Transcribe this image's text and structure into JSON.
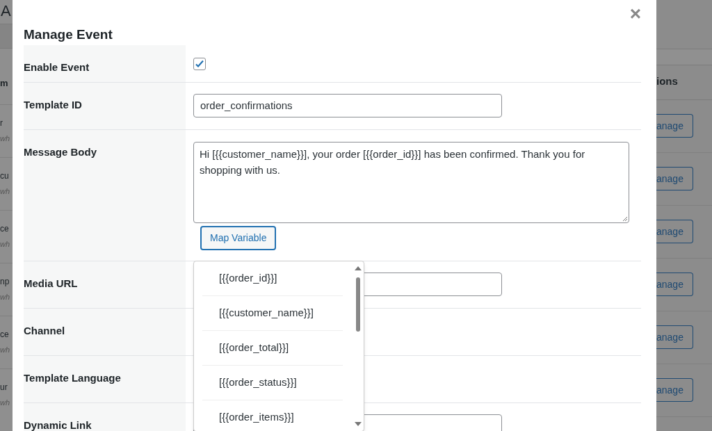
{
  "background": {
    "left_fragments": {
      "title": "A",
      "header": "m",
      "rows": [
        {
          "name": "r",
          "note": "wh"
        },
        {
          "name": "cu",
          "note": "wh"
        },
        {
          "name": "ce",
          "note": "wh"
        },
        {
          "name": "np",
          "note": "wh"
        },
        {
          "name": "ce",
          "note": "wh"
        },
        {
          "name": "ur",
          "note": "wh"
        }
      ]
    },
    "right_fragments": {
      "header": "ions",
      "buttons": [
        "anage",
        "anage",
        "anage",
        "anage",
        "anage",
        "anage"
      ]
    }
  },
  "modal": {
    "title": "Manage Event",
    "close": "×",
    "fields": [
      {
        "kind": "checkbox",
        "label": "Enable Event",
        "checked": true
      },
      {
        "kind": "text",
        "label": "Template ID",
        "value": "order_confirmations"
      },
      {
        "kind": "textarea",
        "label": "Message Body",
        "value": "Hi [{{customer_name}}], your order [{{order_id}}] has been confirmed. Thank you for shopping with us.",
        "button": "Map Variable"
      },
      {
        "kind": "text",
        "label": "Media URL"
      },
      {
        "kind": "blank",
        "label": "Channel"
      },
      {
        "kind": "blank",
        "label": "Template Language"
      },
      {
        "kind": "text",
        "label": "Dynamic Link"
      }
    ],
    "dropdown": {
      "options": [
        "[{{order_id}}]",
        "[{{customer_name}}]",
        "[{{order_total}}]",
        "[{{order_status}}]",
        "[{{order_items}}]"
      ]
    }
  }
}
